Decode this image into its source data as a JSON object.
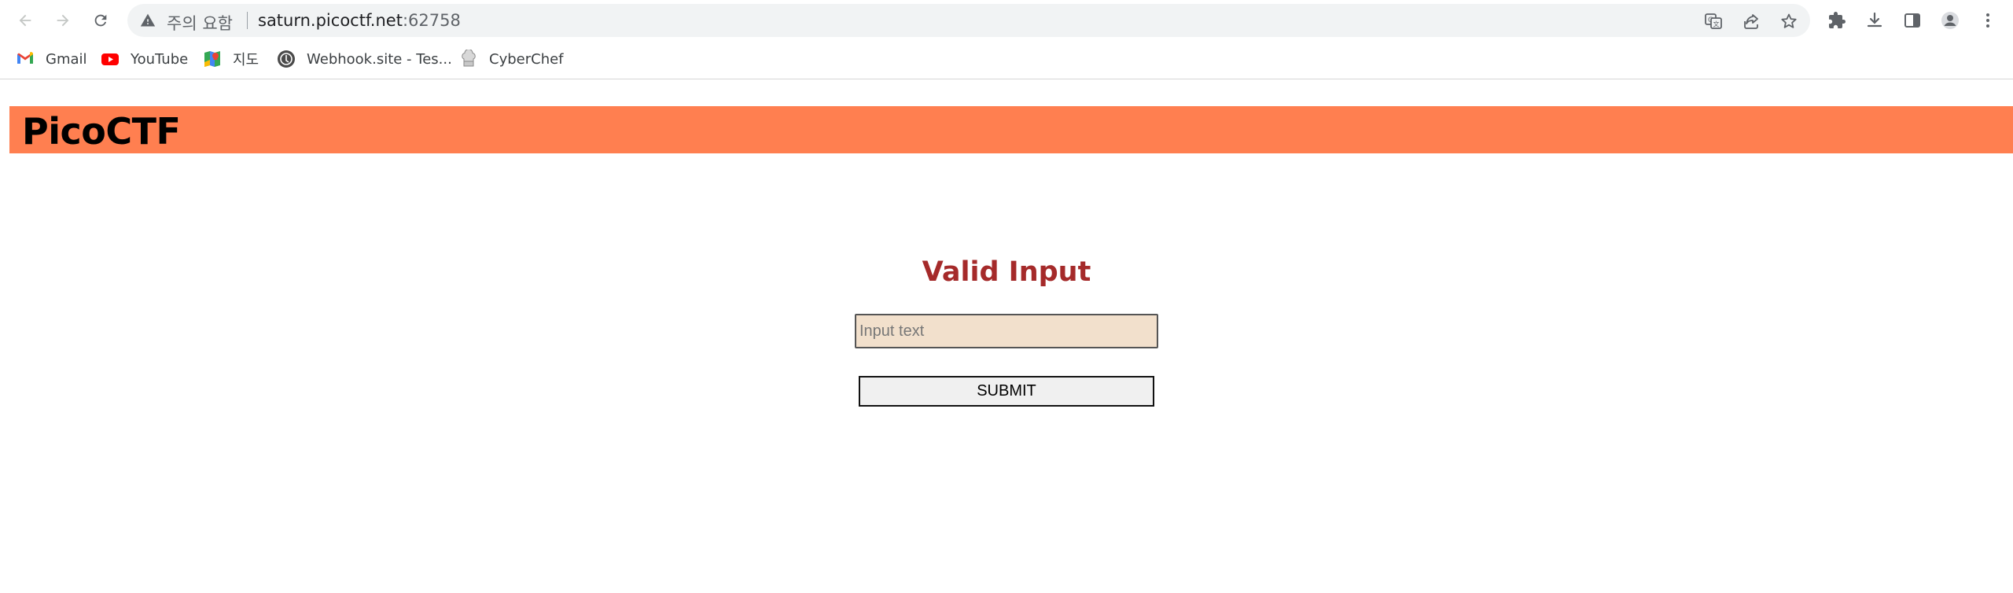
{
  "browser": {
    "address_bar": {
      "security_label": "주의 요함",
      "url_host": "saturn.picoctf.net",
      "url_port": ":62758"
    },
    "nav": {
      "back_icon": "arrow-left",
      "forward_icon": "arrow-right",
      "reload_icon": "reload"
    },
    "bookmarks": [
      {
        "label": "Gmail",
        "icon": "gmail-icon"
      },
      {
        "label": "YouTube",
        "icon": "youtube-icon"
      },
      {
        "label": "지도",
        "icon": "maps-icon"
      },
      {
        "label": "Webhook.site - Tes...",
        "icon": "webhook-icon"
      },
      {
        "label": "CyberChef",
        "icon": "cyberchef-icon"
      }
    ]
  },
  "page": {
    "banner_title": "PicoCTF",
    "heading": "Valid Input",
    "input_placeholder": "Input text",
    "input_value": "",
    "submit_label": "SUBMIT"
  },
  "colors": {
    "banner": "#ff7f50",
    "heading": "#a52a2a",
    "input_bg": "#f2e0cc"
  }
}
